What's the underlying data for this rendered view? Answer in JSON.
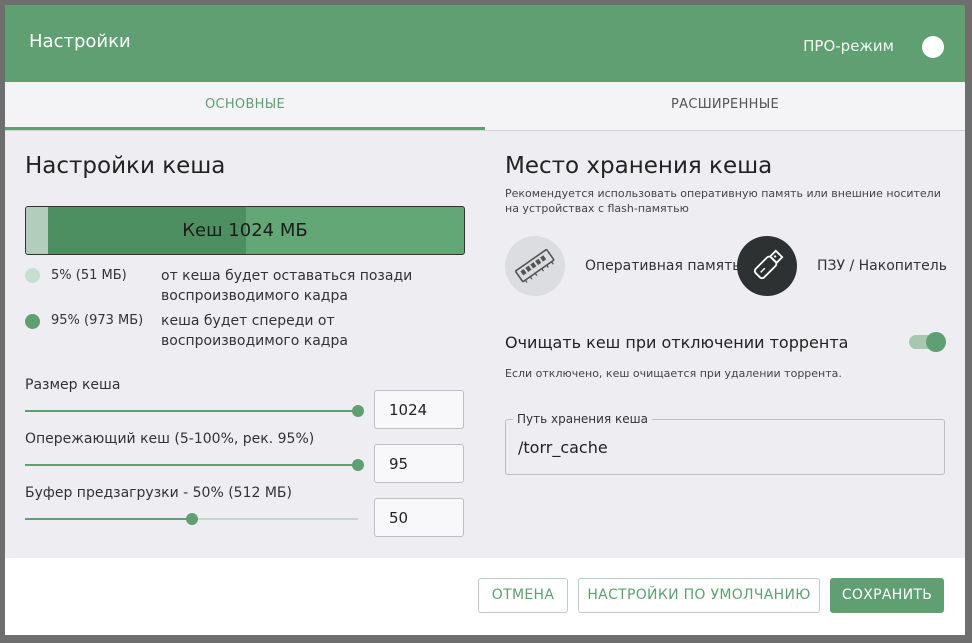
{
  "header": {
    "title": "Настройки",
    "pro_mode_label": "ПРО-режим"
  },
  "tabs": [
    {
      "label": "ОСНОВНЫЕ",
      "active": true
    },
    {
      "label": "РАСШИРЕННЫЕ",
      "active": false
    }
  ],
  "cache": {
    "heading": "Настройки кеша",
    "bar_label": "Кеш 1024 МБ",
    "legend": [
      {
        "pct": "5% (51 МБ)",
        "desc": "от кеша будет оставаться позади воспроизводимого кадра",
        "color": "#c6dfcf"
      },
      {
        "pct": "95% (973 МБ)",
        "desc": "кеша будет спереди от воспроизводимого кадра",
        "color": "#5f9f72"
      }
    ],
    "sliders": [
      {
        "label": "Размер кеша",
        "value": "1024",
        "fraction": 1.0
      },
      {
        "label": "Опережающий кеш (5-100%, рек. 95%)",
        "value": "95",
        "fraction": 1.0
      },
      {
        "label": "Буфер предзагрузки - 50% (512 МБ)",
        "value": "50",
        "fraction": 0.5
      }
    ]
  },
  "storage": {
    "heading": "Место хранения кеша",
    "subtitle": "Рекомендуется использовать оперативную память или внешние носители на устройствах с flash-памятью",
    "options": [
      {
        "label": "Оперативная память",
        "icon": "ram-icon",
        "selected": false
      },
      {
        "label": "ПЗУ / Накопитель",
        "icon": "usb-drive-icon",
        "selected": true
      }
    ],
    "clear_label": "Очищать кеш при отключении торрента",
    "clear_enabled": true,
    "clear_note": "Если отключено, кеш очищается при удалении торрента.",
    "path_label": "Путь хранения кеша",
    "path_value": "/torr_cache"
  },
  "footer": {
    "cancel": "ОТМЕНА",
    "defaults": "НАСТРОЙКИ ПО УМОЛЧАНИЮ",
    "save": "СОХРАНИТЬ"
  },
  "colors": {
    "accent": "#5f9f72",
    "bar_background": "#64a777",
    "bar_back_segment": "#b3cdbd",
    "bar_front_segment": "#4e8f62"
  }
}
